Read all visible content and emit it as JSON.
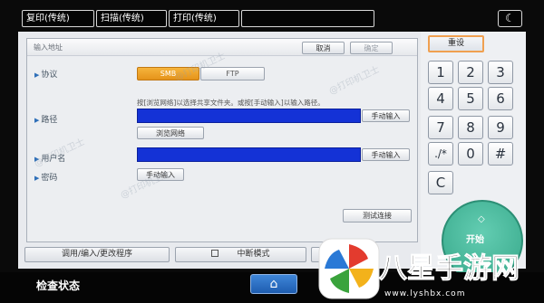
{
  "top_tabs": [
    "复印(传统)",
    "扫描(传统)",
    "打印(传统)",
    ""
  ],
  "icons": {
    "moon": "☾",
    "triangle": "▶",
    "home": "⌂",
    "start": "◇",
    "logo": "colorful-pinwheel-logo"
  },
  "panel": {
    "title": "输入地址",
    "cancel_label": "取消",
    "confirm_label": "确定",
    "protocol": {
      "label": "协议",
      "options": [
        "SMB",
        "FTP"
      ],
      "selected": "SMB"
    },
    "hint": "按[浏览网络]以选择共享文件夹。或按[手动输入]以输入路径。",
    "path": {
      "label": "路径",
      "manual_label": "手动输入",
      "browse_label": "浏览网络"
    },
    "username": {
      "label": "用户名",
      "manual_label": "手动输入"
    },
    "password": {
      "label": "密码",
      "manual_label": "手动输入"
    },
    "test_label": "测试连接"
  },
  "keypad": {
    "reset_label": "重设",
    "keys": [
      "1",
      "2",
      "3",
      "4",
      "5",
      "6",
      "7",
      "8",
      "9",
      "./*",
      "0",
      "#",
      "C"
    ],
    "start_label": "开始"
  },
  "bottom": {
    "program_label": "调用/编入/更改程序",
    "interrupt_label": "中断模式"
  },
  "status": {
    "label": "检查状态"
  },
  "watermarks": [
    "@打印机卫士",
    "@打印机卫士",
    "@打印机卫士",
    "@打印机卫士"
  ],
  "logo": {
    "name": "八星手游网",
    "url": "www.lyshbx.com"
  },
  "colors": {
    "accent_orange": "#e89a25",
    "field_blue": "#1432d6",
    "start_green": "#45b697",
    "home_blue": "#2a6cc4"
  }
}
